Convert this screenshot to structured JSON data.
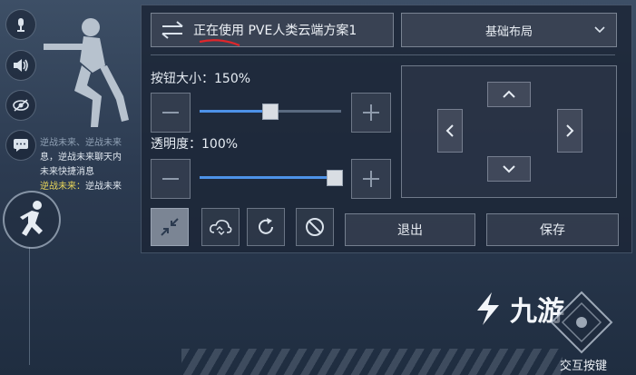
{
  "panel": {
    "plan_label": "正在使用 PVE人类云端方案1",
    "layout_select": "基础布局",
    "button_size_label": "按钮大小：150%",
    "button_size_percent": 150,
    "button_size_slider_fraction": 0.52,
    "opacity_label": "透明度：100%",
    "opacity_percent": 100,
    "opacity_slider_fraction": 1.0,
    "exit_label": "退出",
    "save_label": "保存"
  },
  "chat": {
    "lines": [
      {
        "text": "逆战未来、逆战未来",
        "style": "faded"
      },
      {
        "text": "息，逆战未来聊天内",
        "style": "normal"
      },
      {
        "text": "未来快捷消息",
        "style": "normal"
      },
      {
        "speaker": "逆战未来：",
        "text": "逆战未来",
        "style": "yellow"
      }
    ]
  },
  "hud": {
    "interact_label": "交互按键",
    "logo_text": "九游"
  },
  "colors": {
    "accent": "#4d92e8",
    "annotation_red": "#e0262b",
    "chat_highlight": "#e8d65a"
  }
}
